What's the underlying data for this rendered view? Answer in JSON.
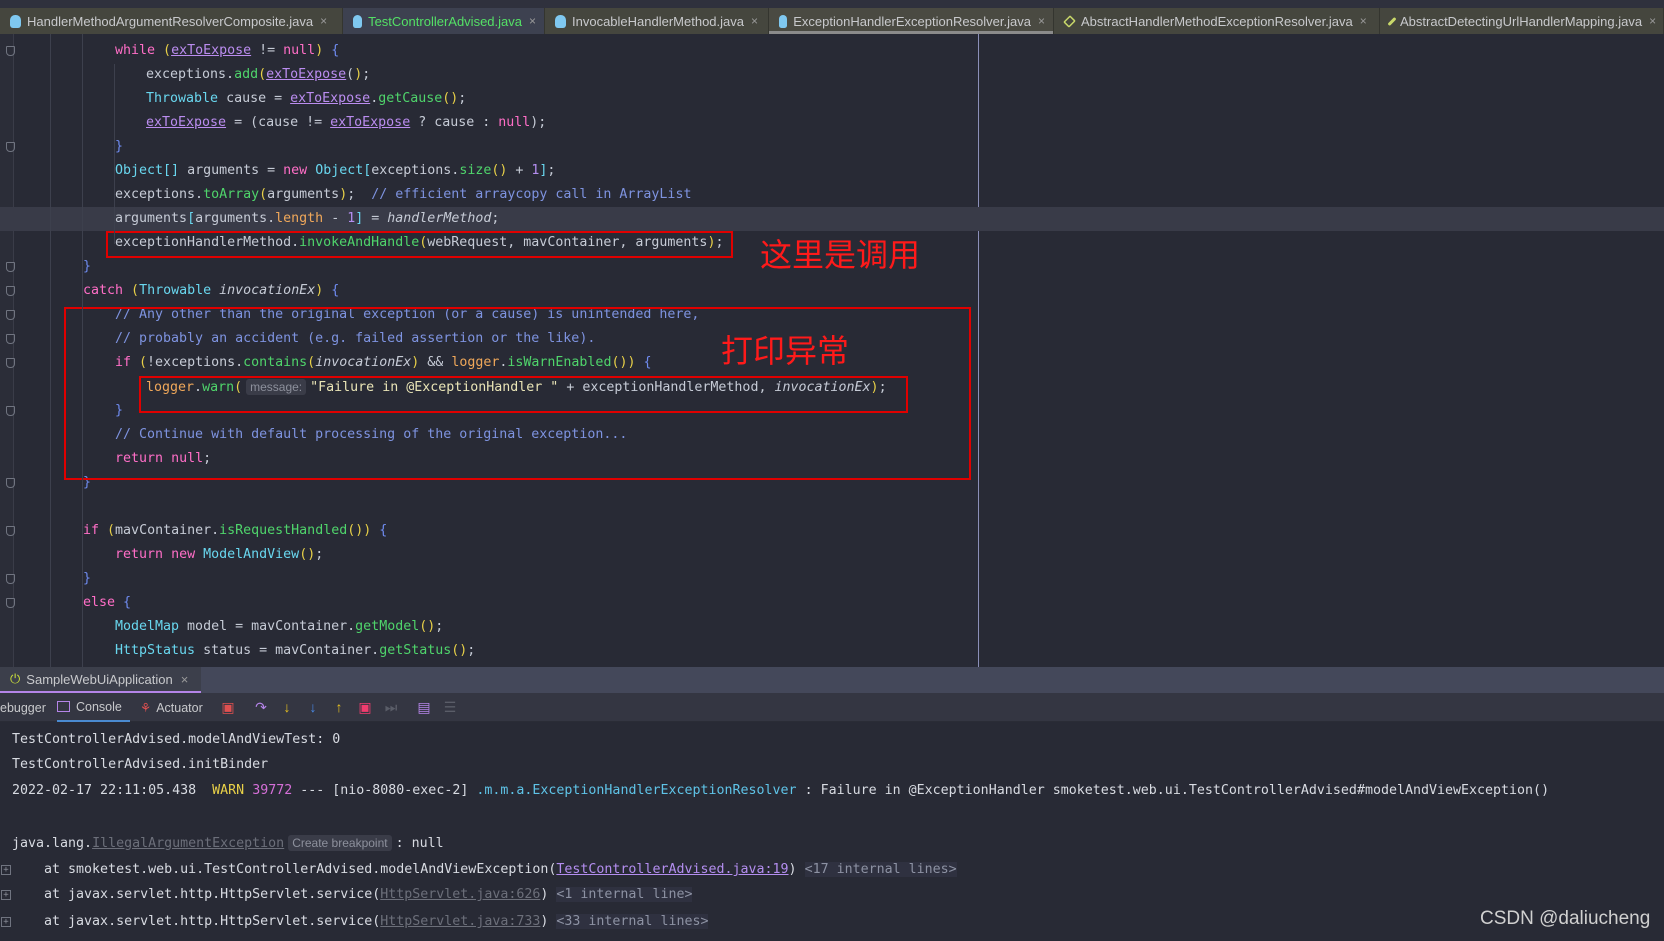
{
  "tabs": [
    {
      "label": "HandlerMethodArgumentResolverComposite.java",
      "icon": "java-class-icon",
      "state": "normal"
    },
    {
      "label": "TestControllerAdvised.java",
      "icon": "java-class-icon",
      "state": "modified"
    },
    {
      "label": "InvocableHandlerMethod.java",
      "icon": "java-class-icon",
      "state": "normal"
    },
    {
      "label": "ExceptionHandlerExceptionResolver.java",
      "icon": "java-class-icon",
      "state": "active"
    },
    {
      "label": "AbstractHandlerMethodExceptionResolver.java",
      "icon": "abstract-class-icon",
      "state": "normal"
    },
    {
      "label": "AbstractDetectingUrlHandlerMapping.java",
      "icon": "abstract-class-icon",
      "state": "normal"
    }
  ],
  "tab_close": "×",
  "code": [
    {
      "indent": 2,
      "t": [
        [
          "while",
          "kw"
        ],
        " ",
        [
          "(",
          "pn"
        ],
        [
          "exToExpose",
          "fld"
        ],
        " != ",
        [
          "null",
          "kw"
        ],
        [
          ")",
          "pn"
        ],
        " ",
        [
          "{",
          "br"
        ]
      ]
    },
    {
      "indent": 3,
      "t": [
        "exceptions.",
        [
          "add",
          "fn"
        ],
        [
          "(",
          "pn"
        ],
        [
          "exToExpose",
          "fld"
        ],
        [
          "(",
          ""
        ],
        [
          ")",
          "pn"
        ],
        ";"
      ]
    },
    {
      "indent": 3,
      "t": [
        [
          "Throwable",
          "ty"
        ],
        " cause = ",
        [
          "exToExpose",
          "fld"
        ],
        ".",
        [
          "getCause",
          "fn"
        ],
        [
          "()",
          "pn"
        ],
        ";"
      ]
    },
    {
      "indent": 3,
      "t": [
        [
          "exToExpose",
          "fld"
        ],
        " = (cause != ",
        [
          "exToExpose",
          "fld"
        ],
        " ? cause : ",
        [
          "null",
          "kw"
        ],
        ");"
      ]
    },
    {
      "indent": 2,
      "t": [
        [
          "}",
          "br"
        ]
      ]
    },
    {
      "indent": 2,
      "t": [
        [
          "Object",
          "ty"
        ],
        [
          "[]",
          "ty"
        ],
        " arguments = ",
        [
          "new",
          "kw"
        ],
        " ",
        [
          "Object",
          "ty"
        ],
        [
          "[",
          "ty"
        ],
        "exceptions.",
        [
          "size",
          "fn"
        ],
        [
          "()",
          "pn"
        ],
        " + ",
        [
          "1",
          "num"
        ],
        [
          "]",
          "ty"
        ],
        ";"
      ]
    },
    {
      "indent": 2,
      "t": [
        "exceptions.",
        [
          "toArray",
          "fn"
        ],
        [
          "(",
          "pn"
        ],
        "arguments",
        [
          ")",
          "pn"
        ],
        ";  ",
        [
          "// efficient arraycopy call in ArrayList",
          "cm"
        ]
      ]
    },
    {
      "indent": 2,
      "hl": true,
      "t": [
        "arguments",
        [
          "[",
          "ty"
        ],
        "arguments.",
        [
          "length",
          "fd"
        ],
        " - ",
        [
          "1",
          "num"
        ],
        [
          "]",
          "ty"
        ],
        " = ",
        [
          "handlerMethod",
          "it"
        ],
        ";"
      ]
    },
    {
      "indent": 2,
      "t": [
        "exceptionHandlerMethod.",
        [
          "invokeAndHandle",
          "fn"
        ],
        [
          "(",
          "pn"
        ],
        "webRequest, mavContainer, arguments",
        [
          ")",
          "pn"
        ],
        ";"
      ]
    },
    {
      "indent": 1,
      "t": [
        [
          "}",
          "br"
        ]
      ]
    },
    {
      "indent": 1,
      "t": [
        [
          "catch",
          "kw"
        ],
        " ",
        [
          "(",
          "pn"
        ],
        [
          "Throwable",
          "ty"
        ],
        " ",
        [
          "invocationEx",
          "it"
        ],
        [
          ")",
          "pn"
        ],
        " ",
        [
          "{",
          "br"
        ]
      ]
    },
    {
      "indent": 2,
      "t": [
        [
          "// Any other than the original exception (or a cause) is unintended here,",
          "cm"
        ]
      ]
    },
    {
      "indent": 2,
      "t": [
        [
          "// probably an accident (e.g. failed assertion or the like).",
          "cm"
        ]
      ]
    },
    {
      "indent": 2,
      "t": [
        [
          "if",
          "kw"
        ],
        " ",
        [
          "(",
          "pn"
        ],
        "!exceptions.",
        [
          "contains",
          "fn"
        ],
        [
          "(",
          "pn"
        ],
        [
          "invocationEx",
          "it"
        ],
        [
          ")",
          "pn"
        ],
        " && ",
        [
          "logger",
          "lg"
        ],
        ".",
        [
          "isWarnEnabled",
          "fn"
        ],
        [
          "()",
          "pn"
        ],
        [
          ")",
          "pn"
        ],
        " ",
        [
          "{",
          "br"
        ]
      ]
    },
    {
      "indent": 3,
      "t": [
        [
          "logger",
          "lg"
        ],
        ".",
        [
          "warn",
          "fn"
        ],
        [
          "(",
          "pn"
        ],
        [
          "message:",
          "hint"
        ],
        [
          "\"Failure in @ExceptionHandler \"",
          "st"
        ],
        " + exceptionHandlerMethod, ",
        [
          "invocationEx",
          "it"
        ],
        [
          ")",
          "pn"
        ],
        ";"
      ]
    },
    {
      "indent": 2,
      "t": [
        [
          "}",
          "br"
        ]
      ]
    },
    {
      "indent": 2,
      "t": [
        [
          "// Continue with default processing of the original exception...",
          "cm"
        ]
      ]
    },
    {
      "indent": 2,
      "t": [
        [
          "return",
          "kw"
        ],
        " ",
        [
          "null",
          "kw"
        ],
        ";"
      ]
    },
    {
      "indent": 1,
      "t": [
        [
          "}",
          "br"
        ]
      ]
    },
    {
      "indent": 0,
      "t": []
    },
    {
      "indent": 1,
      "t": [
        [
          "if",
          "kw"
        ],
        " ",
        [
          "(",
          "pn"
        ],
        "mavContainer.",
        [
          "isRequestHandled",
          "fn"
        ],
        [
          "()",
          "pn"
        ],
        [
          ")",
          "pn"
        ],
        " ",
        [
          "{",
          "br"
        ]
      ]
    },
    {
      "indent": 2,
      "t": [
        [
          "return",
          "kw"
        ],
        " ",
        [
          "new",
          "kw"
        ],
        " ",
        [
          "ModelAndView",
          "ty"
        ],
        [
          "()",
          "pn"
        ],
        ";"
      ]
    },
    {
      "indent": 1,
      "t": [
        [
          "}",
          "br"
        ]
      ]
    },
    {
      "indent": 1,
      "t": [
        [
          "else",
          "kw"
        ],
        " ",
        [
          "{",
          "br"
        ]
      ]
    },
    {
      "indent": 2,
      "t": [
        [
          "ModelMap",
          "ty"
        ],
        " model = mavContainer.",
        [
          "getModel",
          "fn"
        ],
        [
          "()",
          "pn"
        ],
        ";"
      ]
    },
    {
      "indent": 2,
      "t": [
        [
          "HttpStatus",
          "ty"
        ],
        " status = mavContainer.",
        [
          "getStatus",
          "fn"
        ],
        [
          "()",
          "pn"
        ],
        ";"
      ]
    }
  ],
  "annotations": {
    "invoke_note": "这里是调用",
    "print_note": "打印异常"
  },
  "run": {
    "config": "SampleWebUiApplication",
    "close": "×"
  },
  "toolbar": {
    "debugger": "ebugger",
    "console": "Console",
    "actuator": "Actuator"
  },
  "console": [
    {
      "t": [
        "TestControllerAdvised.modelAndViewTest: 0"
      ]
    },
    {
      "t": [
        "TestControllerAdvised.initBinder"
      ]
    },
    {
      "t": [
        "2022-02-17 22:11:05.438  ",
        [
          "WARN",
          "warn"
        ],
        " ",
        [
          "39772",
          "pid"
        ],
        " --- [nio-8080-exec-2] ",
        [
          ".m.m.a.ExceptionHandlerExceptionResolver",
          "cls"
        ],
        " : Failure in @ExceptionHandler smoketest.web.ui.TestControllerAdvised#modelAndViewException()"
      ]
    },
    {
      "t": []
    },
    {
      "t": [
        "java.lang.",
        [
          "IllegalArgumentException",
          "glnk"
        ],
        [
          "Create breakpoint",
          "hint"
        ],
        ": null"
      ]
    },
    {
      "exp": true,
      "t": [
        "    at smoketest.web.ui.TestControllerAdvised.modelAndViewException(",
        [
          "TestControllerAdvised.java:19",
          "lnk"
        ],
        ") ",
        [
          "<17 internal lines>",
          "intl"
        ]
      ]
    },
    {
      "exp": true,
      "t": [
        "    at javax.servlet.http.HttpServlet.service(",
        [
          "HttpServlet.java:626",
          "glnk"
        ],
        ") ",
        [
          "<1 internal line>",
          "intl"
        ]
      ]
    },
    {
      "exp": true,
      "t": [
        "    at javax.servlet.http.HttpServlet.service(",
        [
          "HttpServlet.java:733",
          "glnk"
        ],
        ") ",
        [
          "<33 internal lines>",
          "intl"
        ]
      ]
    }
  ],
  "watermark": "CSDN @daliucheng"
}
